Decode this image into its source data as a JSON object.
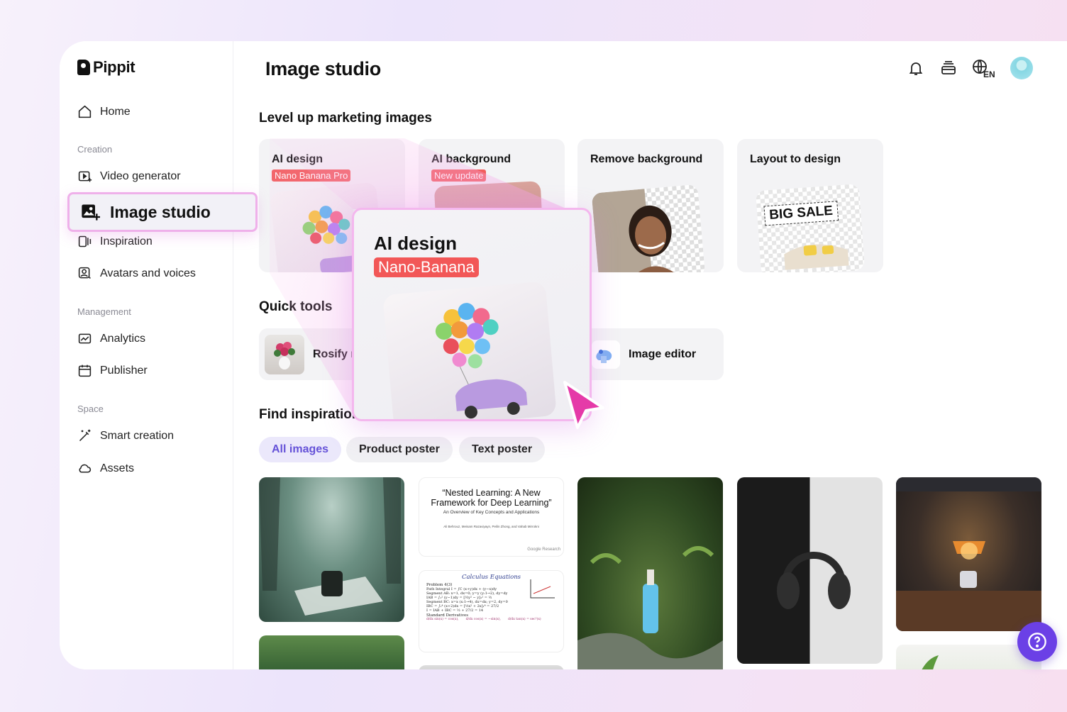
{
  "brand": {
    "name": "Pippit"
  },
  "page": {
    "title": "Image studio"
  },
  "topbar": {
    "language_label": "EN"
  },
  "sidebar": {
    "home": "Home",
    "creation_label": "Creation",
    "video_generator": "Video generator",
    "image_studio": "Image studio",
    "inspiration": "Inspiration",
    "avatars": "Avatars and voices",
    "management_label": "Management",
    "analytics": "Analytics",
    "publisher": "Publisher",
    "space_label": "Space",
    "smart_creation": "Smart creation",
    "assets": "Assets"
  },
  "marketing": {
    "heading": "Level up marketing images",
    "cards": [
      {
        "title": "AI design",
        "badge": "Nano Banana Pro"
      },
      {
        "title": "AI background",
        "badge": "New update"
      },
      {
        "title": "Remove background",
        "badge": ""
      },
      {
        "title": "Layout to design",
        "badge": "",
        "image_text": "BIG SALE"
      }
    ]
  },
  "quick_tools": {
    "heading": "Quick tools",
    "items": [
      {
        "label": "Rosify r"
      },
      {
        "label": "Image editor"
      }
    ]
  },
  "inspiration": {
    "heading": "Find inspiration",
    "filters": [
      {
        "label": "All images",
        "active": true
      },
      {
        "label": "Product poster",
        "active": false
      },
      {
        "label": "Text poster",
        "active": false
      }
    ],
    "doc_card": {
      "title_line1": "“Nested Learning: A New",
      "title_line2": "Framework for Deep Learning”",
      "subtitle": "An Overview of Key Concepts and Applications",
      "authors": "Ali Behrouz, Meisam Razaviyayn, Peilin Zhong, and Vahab Mirrokni",
      "footer": "Google Research"
    },
    "math_card": {
      "title": "Calculus Equations",
      "problem": "Problem 4(3)",
      "line1": "Path Integral  I = ∫C (x+y)dx + (y−x)dy",
      "line2": "Segment AB: x=1, dx=0; y=y (y:1→2), dy=dy",
      "line3": "IAB = ∫₁² (y−1)dy = [½y² − y]₁² = ½",
      "line4": "Segment BC: x=x (x:1→4), dx=dx; y=2, dy=0",
      "line5": "IBC = ∫₁⁴ (x+2)dx = [½x² + 2x]₁⁴ = 27/2",
      "line6": "I = IAB + IBC = ½ + 27/2 = 14",
      "derivatives": "Standard Derivatives",
      "d1": "d/dx sin(x) = cos(x),",
      "d2": "d/dx cos(x) = −sin(x),",
      "d3": "d/dx tan(x) = sec²(x)"
    }
  },
  "popup": {
    "title": "AI design",
    "badge": "Nano-Banana"
  },
  "colors": {
    "accent": "#6b40e6",
    "badge_red": "#f25c5c",
    "highlight_pink": "#efb0ea"
  }
}
